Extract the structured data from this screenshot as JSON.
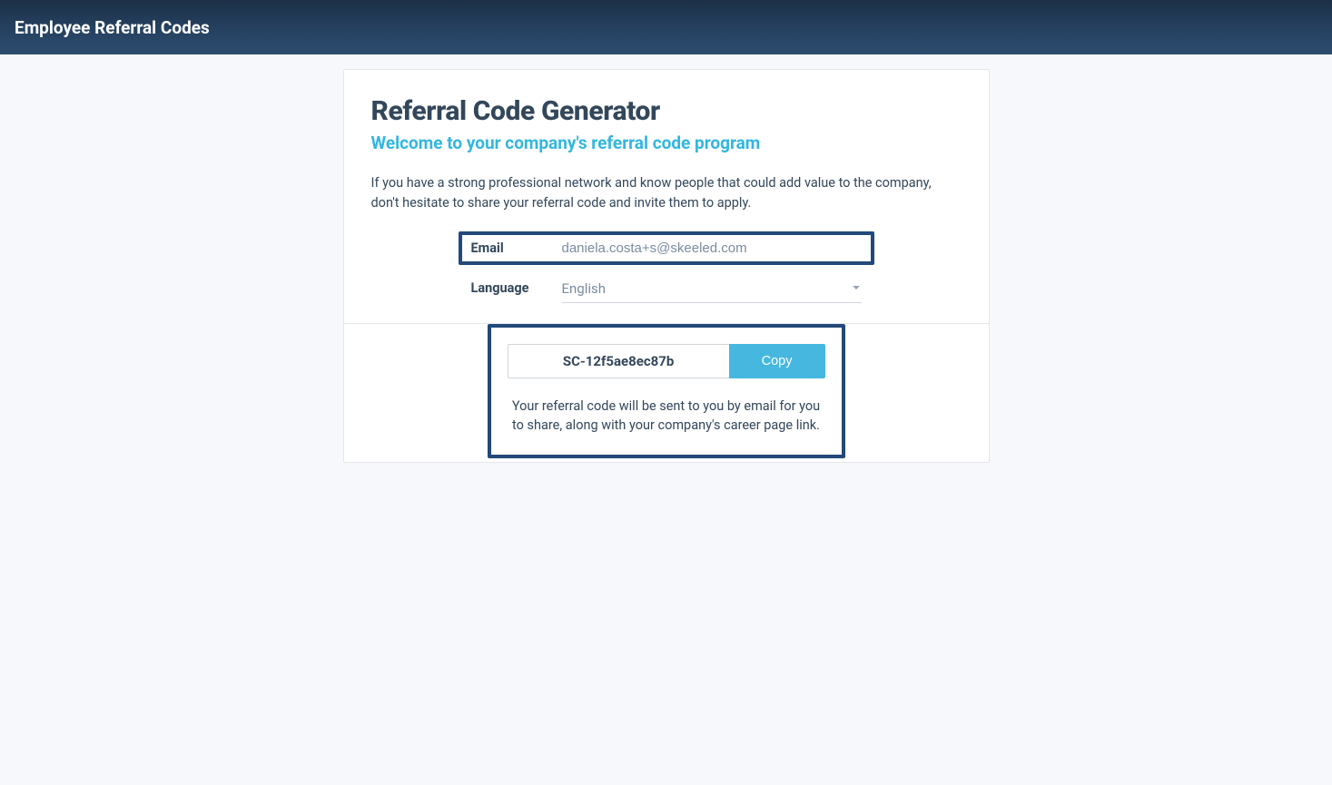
{
  "header": {
    "title": "Employee Referral Codes"
  },
  "card": {
    "title": "Referral Code Generator",
    "subtitle": "Welcome to your company's referral code program",
    "description": "If you have a strong professional network and know people that could add value to the company, don't hesitate to share your referral code and invite them to apply."
  },
  "form": {
    "email_label": "Email",
    "email_value": "daniela.costa+s@skeeled.com",
    "language_label": "Language",
    "language_value": "English"
  },
  "result": {
    "code": "SC-12f5ae8ec87b",
    "copy_label": "Copy",
    "note": "Your referral code will be sent to you by email for you to share, along with your company's career page link."
  }
}
